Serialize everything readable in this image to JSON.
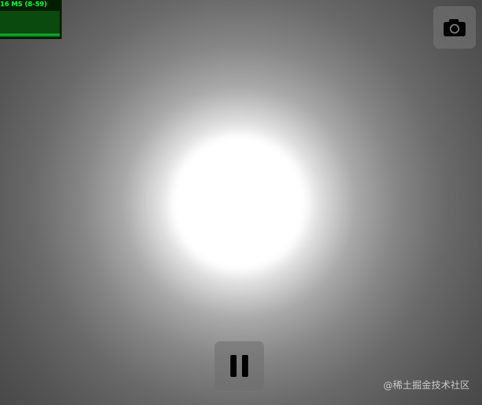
{
  "stats": {
    "label": "16 MS (8-59)",
    "text_color": "#00ff3a",
    "background_color": "#001f00"
  },
  "toolbar": {
    "camera_button_icon": "camera-icon",
    "pause_button_icon": "pause-icon"
  },
  "watermark": {
    "text": "@稀土掘金技术社区"
  },
  "scene": {
    "background_color": "#3a3a3a",
    "sun_color": "#ffffff"
  }
}
